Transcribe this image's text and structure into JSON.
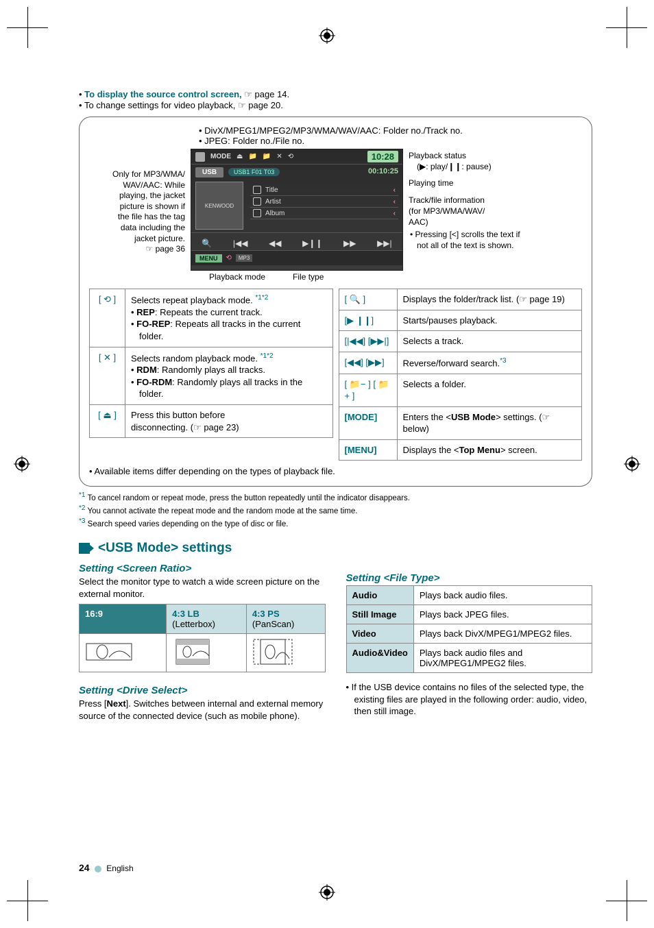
{
  "intro": {
    "line1_prefix": "To display the source control screen, ",
    "line1_suffix": " page 14.",
    "line2_prefix": "To change settings for video playback, ",
    "line2_suffix": " page 20."
  },
  "top_bullets": {
    "b1": "DivX/MPEG1/MPEG2/MP3/WMA/WAV/AAC: Folder no./Track no.",
    "b2": "JPEG: Folder no./File no."
  },
  "diagram": {
    "left_note_line1": "Only for MP3/WMA/",
    "left_note_line2": "WAV/AAC: While",
    "left_note_line3": "playing, the jacket",
    "left_note_line4": "picture is shown if",
    "left_note_line5": "the file has the tag",
    "left_note_line6": "data including the",
    "left_note_line7": "jacket picture.",
    "left_note_ref": " page 36",
    "screen": {
      "mode": "MODE",
      "usb": "USB",
      "pill": "USB1  F01  T03",
      "time_badge": "10:28",
      "playtime": "00:10:25",
      "title": "Title",
      "artist": "Artist",
      "album": "Album",
      "brand": "KENWOOD",
      "menu": "MENU"
    },
    "right": {
      "g1": "Playback status",
      "g1_sub": "(▶: play/❙❙: pause)",
      "g2": "Playing time",
      "g3": "Track/file information",
      "g3_sub1": "(for MP3/WMA/WAV/",
      "g3_sub2": "AAC)",
      "g3_b": "Pressing [<] scrolls the text if not all of the text is shown."
    },
    "under": {
      "l1": "Playback mode",
      "l2": "File type"
    }
  },
  "left_table": {
    "r1_key": "[ ⟲ ]",
    "r1_l1_pre": "Selects repeat playback mode. ",
    "r1_l1_sup": "*1*2",
    "r1_b1_b": "REP",
    "r1_b1_t": ": Repeats the current track.",
    "r1_b2_b": "FO-REP",
    "r1_b2_t": ": Repeats all tracks in the current folder.",
    "r2_key": "[ ✕ ]",
    "r2_l1_pre": "Selects random playback mode. ",
    "r2_l1_sup": "*1*2",
    "r2_b1_b": "RDM",
    "r2_b1_t": ": Randomly plays all tracks.",
    "r2_b2_b": "FO-RDM",
    "r2_b2_t": ": Randomly plays all tracks in the folder.",
    "r3_key": "[ ⏏ ]",
    "r3_t1": "Press this button before",
    "r3_t2": "disconnecting. (☞ page 23)"
  },
  "right_table": {
    "r1_key": "[ 🔍 ]",
    "r1_t": "Displays the folder/track list. (☞ page 19)",
    "r2_key": "[▶ ❙❙]",
    "r2_t": "Starts/pauses playback.",
    "r3_key": "[|◀◀] [▶▶|]",
    "r3_t": "Selects a track.",
    "r4_key": "[◀◀] [▶▶]",
    "r4_t_pre": "Reverse/forward search.",
    "r4_t_sup": "*3",
    "r5_key": "[ 📁− ] [ 📁+ ]",
    "r5_t": "Selects a folder.",
    "r6_key": "[MODE]",
    "r6_t_pre": "Enters the <",
    "r6_t_b": "USB Mode",
    "r6_t_post": "> settings. (☞ below)",
    "r7_key": "[MENU]",
    "r7_t_pre": "Displays the <",
    "r7_t_b": "Top Menu",
    "r7_t_post": "> screen."
  },
  "avail_note": "Available items differ depending on the types of playback file.",
  "footnotes": {
    "f1": "To cancel random or repeat mode, press the button repeatedly until the indicator disappears.",
    "f2": "You cannot activate the repeat mode and the random mode at the same time.",
    "f3": "Search speed varies depending on the type of disc or file.",
    "s1": "*1",
    "s2": "*2",
    "s3": "*3"
  },
  "section_title": "<USB Mode> settings",
  "left_col": {
    "h_ratio": "Setting <Screen Ratio>",
    "p_ratio": "Select the monitor type to watch a wide screen picture on the external monitor.",
    "ratio_table": {
      "c1": "16:9",
      "c2a": "4:3 LB",
      "c2b": "(Letterbox)",
      "c3a": "4:3 PS",
      "c3b": "(PanScan)"
    },
    "h_drive": "Setting <Drive Select>",
    "p_drive_pre": "Press [",
    "p_drive_b": "Next",
    "p_drive_post": "]. Switches between internal and external memory source of the connected device (such as mobile phone)."
  },
  "right_col": {
    "h_file": "Setting <File Type>",
    "t": {
      "r1k": "Audio",
      "r1v": "Plays back audio files.",
      "r2k": "Still Image",
      "r2v": "Plays back JPEG files.",
      "r3k": "Video",
      "r3v": "Plays back DivX/MPEG1/MPEG2 files.",
      "r4k": "Audio&Video",
      "r4v": "Plays back audio files and DivX/MPEG1/MPEG2 files."
    },
    "note": "If the USB device contains no files of the selected type, the existing files are played in the following order: audio, video, then still image."
  },
  "page": {
    "num": "24",
    "lang": "English"
  }
}
